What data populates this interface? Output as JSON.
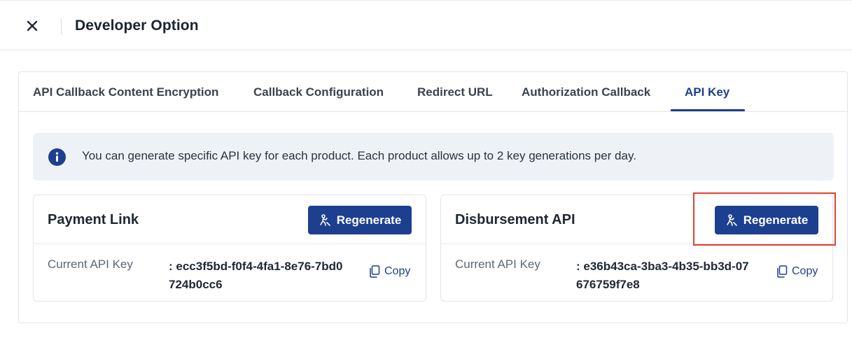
{
  "header": {
    "title": "Developer Option",
    "close_icon": "close-icon"
  },
  "tabs": [
    {
      "label": "API Callback Content Encryption",
      "active": false
    },
    {
      "label": "Callback Configuration",
      "active": false
    },
    {
      "label": "Redirect URL",
      "active": false
    },
    {
      "label": "Authorization Callback",
      "active": false
    },
    {
      "label": "API Key",
      "active": true
    }
  ],
  "info": {
    "icon": "info-icon",
    "text": "You can generate specific API key for each product. Each product allows up to 2 key generations per day."
  },
  "cards": [
    {
      "title": "Payment Link",
      "regenerate_label": "Regenerate",
      "key_label": "Current API Key",
      "key_value": ": ecc3f5bd-f0f4-4fa1-8e76-7bd0724b0cc6",
      "copy_label": "Copy"
    },
    {
      "title": "Disbursement API",
      "regenerate_label": "Regenerate",
      "key_label": "Current API Key",
      "key_value": ": e36b43ca-3ba3-4b35-bb3d-07676759f7e8",
      "copy_label": "Copy"
    }
  ],
  "colors": {
    "primary": "#1d3f8f",
    "banner_bg": "#eef2f7",
    "highlight": "#e0412d"
  }
}
